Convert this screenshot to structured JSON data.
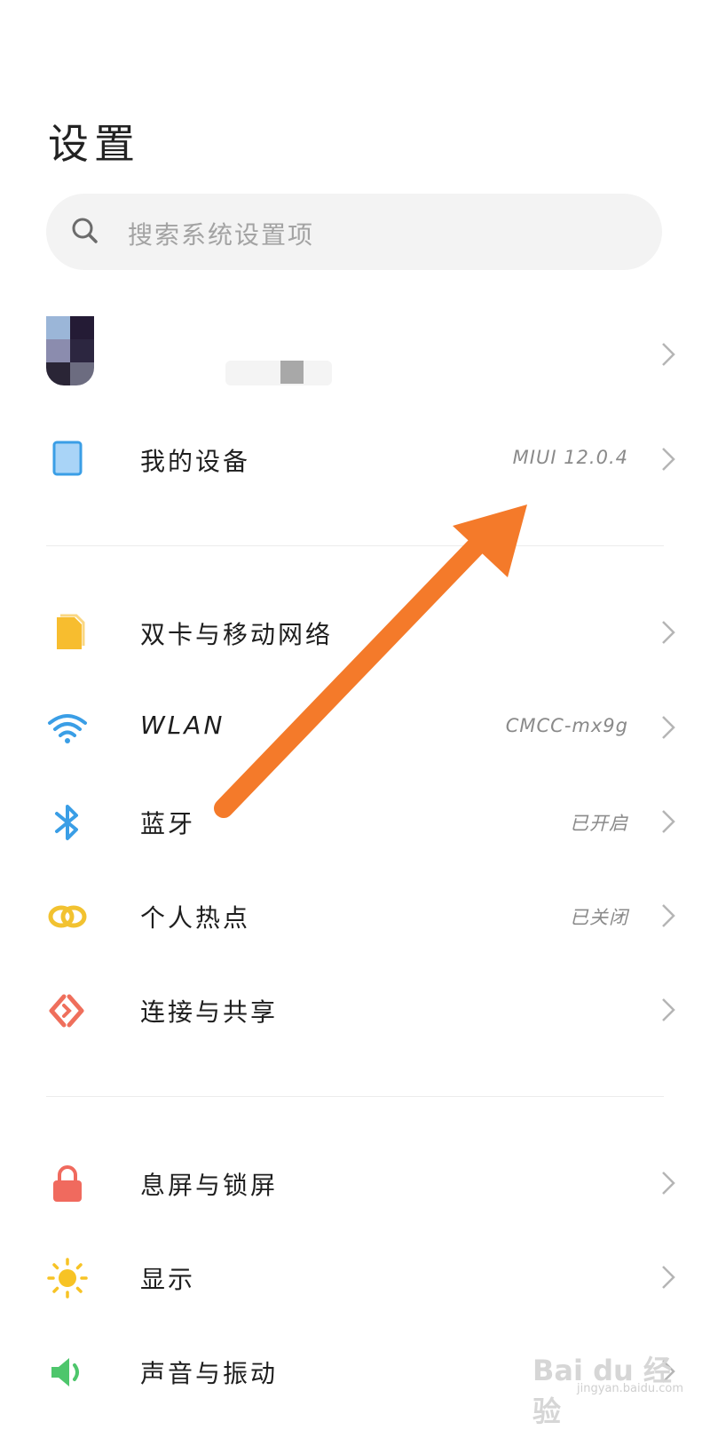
{
  "page": {
    "title": "设置"
  },
  "search": {
    "placeholder": "搜索系统设置项"
  },
  "rows": {
    "my_device": {
      "label": "我的设备",
      "value": "MIUI 12.0.4",
      "icon": "tablet-icon"
    },
    "sim": {
      "label": "双卡与移动网络",
      "icon": "sim-card-icon"
    },
    "wlan": {
      "label": "WLAN",
      "value": "CMCC-mx9g",
      "icon": "wifi-icon"
    },
    "bluetooth": {
      "label": "蓝牙",
      "value": "已开启",
      "icon": "bluetooth-icon"
    },
    "hotspot": {
      "label": "个人热点",
      "value": "已关闭",
      "icon": "hotspot-icon"
    },
    "connection": {
      "label": "连接与共享",
      "icon": "connection-share-icon"
    },
    "lockscreen": {
      "label": "息屏与锁屏",
      "icon": "lock-icon"
    },
    "display": {
      "label": "显示",
      "icon": "sun-icon"
    },
    "sound": {
      "label": "声音与振动",
      "icon": "speaker-icon"
    }
  },
  "watermark": {
    "text": "Bai du 经验",
    "sub": "jingyan.baidu.com"
  },
  "colors": {
    "accent_arrow": "#f47a2a",
    "wifi_blue": "#3a9ee6",
    "sim_yellow": "#f7bd2f",
    "hotspot_yellow": "#f2c230",
    "connection_red": "#ef6f5c",
    "lock_red": "#f06a5e",
    "sun_yellow": "#f7c325",
    "sound_green": "#4ec66c"
  }
}
